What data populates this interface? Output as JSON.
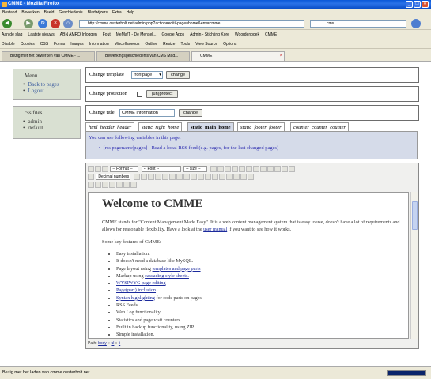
{
  "window": {
    "title": "CMME - Mozilla Firefox"
  },
  "menu": [
    "Bestand",
    "Bewerken",
    "Beeld",
    "Geschiedenis",
    "Bladwijzers",
    "Extra",
    "Help"
  ],
  "nav": {
    "url": "http://cmme.oesterholt.net/admin.php?action=edit&page=home&env=cmme",
    "search_value": "cms"
  },
  "bookmarks_row1": [
    "Aan de slag",
    "Laatste nieuws",
    "ABN AMRO Inloggen",
    "Fout",
    "MeMa!T - De Mensel...",
    "Google Apps",
    "Admin - Stichting Kore",
    "Woordenboek",
    "CMME"
  ],
  "bookmarks_row2": [
    "Disable",
    "Cookies",
    "CSS",
    "Forms",
    "Images",
    "Information",
    "Miscellaneous",
    "Outline",
    "Resize",
    "Tools",
    "View Source",
    "Options"
  ],
  "browser_tabs": [
    {
      "label": "Bezig met het bewerken van CMME - ..."
    },
    {
      "label": "Bewerkingsgeschiedenis van CMS Mad..."
    },
    {
      "label": "CMME"
    }
  ],
  "sidebar": {
    "menu_title": "Menu",
    "menu_items": [
      "Back to pages",
      "Logout"
    ],
    "css_title": "css files",
    "css_items": [
      "admin",
      "default"
    ]
  },
  "template": {
    "label": "Change template",
    "value": "frontpage",
    "button": "change"
  },
  "protection": {
    "label": "Change protection",
    "button": "(un)protect"
  },
  "titlebox": {
    "label": "Change title",
    "value": "CMME Information",
    "button": "change"
  },
  "page_tabs": [
    "html_header_header",
    "static_right_home",
    "static_main_home",
    "static_footer_footer",
    "counter_counter_counter"
  ],
  "variables": {
    "intro": "You can use following variables in this page.",
    "item": "[rss pagename|pages] - Read a local RSS feed (e.g. pages, for the last changed pages)"
  },
  "toolbar": {
    "format": "-- Format --",
    "font": "-- Font --",
    "size": "-- size --",
    "list_type": "Decimal numbers"
  },
  "content": {
    "heading": "Welcome to CMME",
    "p1_a": "CMME stands for \"Content Management Made Easy\". It is a web content management system that is easy to use, doesn't have a lot of requirements and allows for reasonable flexibility. Have a look at the ",
    "p1_link": "user manual",
    "p1_b": " if you want to see how it works.",
    "p2": "Some key features of CMME:",
    "features": [
      {
        "pre": "Easy installation.",
        "link": "",
        "post": ""
      },
      {
        "pre": "It doesn't need a database like MySQL.",
        "link": "",
        "post": ""
      },
      {
        "pre": "Page layout using ",
        "link": "templates and page parts",
        "post": ""
      },
      {
        "pre": "Markup using ",
        "link": "cascading style sheets.",
        "post": ""
      },
      {
        "pre": "",
        "link": "WYSIWYG page editing",
        "post": ""
      },
      {
        "pre": "",
        "link": "Page(part) inclusion",
        "post": ""
      },
      {
        "pre": "",
        "link": "Syntax highlighting",
        "post": " for code parts on pages"
      },
      {
        "pre": "RSS Feeds.",
        "link": "",
        "post": ""
      },
      {
        "pre": "Web Log functionality.",
        "link": "",
        "post": ""
      },
      {
        "pre": "Statistics and page visit counters",
        "link": "",
        "post": ""
      },
      {
        "pre": "Built in backup functionality, using ZIP.",
        "link": "",
        "post": ""
      },
      {
        "pre": "Simple installation.",
        "link": "",
        "post": ""
      }
    ]
  },
  "path": {
    "label": "Path:",
    "items": [
      "body",
      "ul",
      "li"
    ]
  },
  "status": {
    "text": "Bezig met het laden van cmme.oesterholt.net..."
  }
}
